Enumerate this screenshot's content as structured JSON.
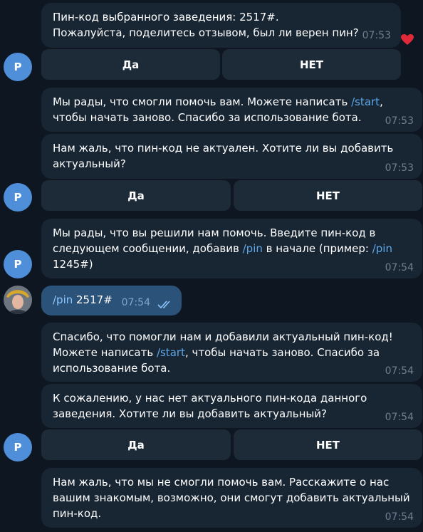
{
  "bot_avatar_letter": "P",
  "accent_link_color": "#5ea8e8",
  "messages": [
    {
      "text": "Пин-код выбранного заведения: 2517#.\nПожалуйста, поделитесь отзывом, был ли верен пин?",
      "time": "07:53",
      "reaction": "heart-icon",
      "buttons": [
        "Да",
        "НЕТ"
      ]
    },
    {
      "parts": [
        "Мы рады, что смогли помочь вам. Можете написать ",
        "/start",
        ",\nчтобы начать заново. Спасибо за использование бота."
      ],
      "time": "07:53"
    },
    {
      "text": "Нам жаль, что пин-код не актуален. Хотите ли вы добавить\nактуальный?",
      "time": "07:53",
      "buttons": [
        "Да",
        "НЕТ"
      ]
    },
    {
      "parts": [
        "Мы рады, что вы решили нам помочь. Введите пин-код в\nследующем сообщении, добавив ",
        "/pin",
        " в начале (пример: ",
        "/pin",
        "\n1245#)"
      ],
      "time": "07:54"
    },
    {
      "outgoing": true,
      "parts": [
        "/pin",
        " 2517#"
      ],
      "time": "07:54",
      "status_icon": "double-check-icon"
    },
    {
      "parts": [
        "Спасибо, что помогли нам и добавили актуальный пин-код!\nМожете написать ",
        "/start",
        ", чтобы начать заново. Спасибо за\nиспользование бота."
      ],
      "time": "07:54"
    },
    {
      "text": "К сожалению, у нас нет актуального пин-кода данного\nзаведения. Хотите ли вы добавить актуальный?",
      "time": "07:54",
      "buttons": [
        "Да",
        "НЕТ"
      ]
    },
    {
      "text": "Нам жаль, что мы не смогли помочь вам. Расскажите о нас\nвашим знакомым, возможно, они смогут добавить актуальный\nпин-код.",
      "time": "07:54"
    }
  ]
}
